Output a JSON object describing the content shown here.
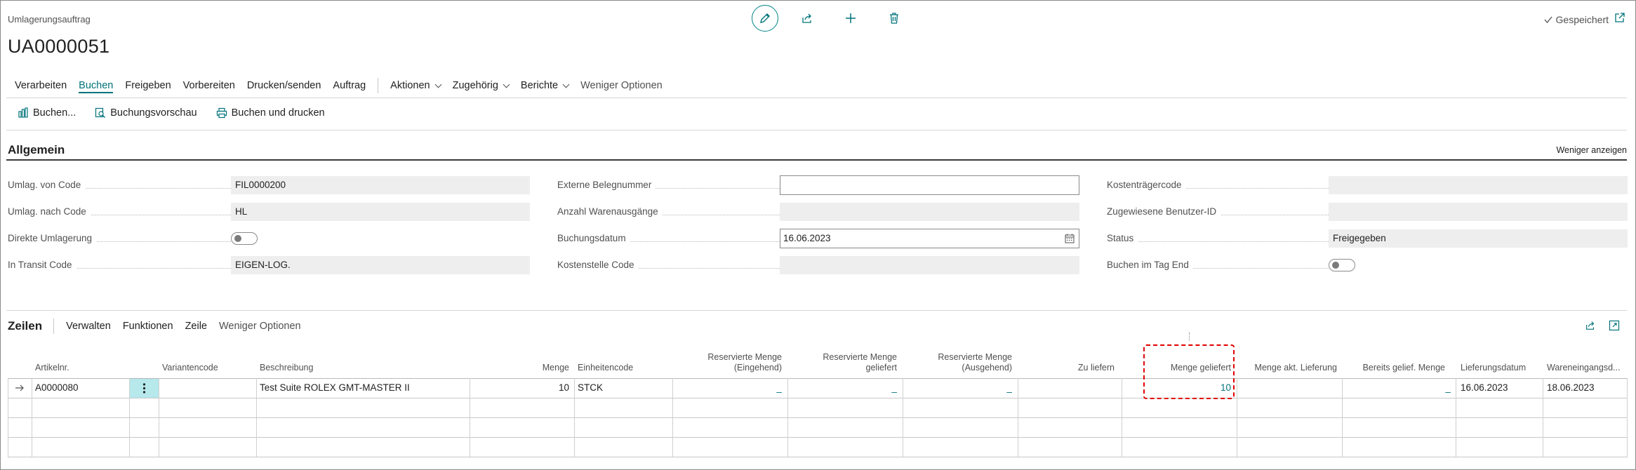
{
  "header": {
    "caption": "Umlagerungsauftrag",
    "title": "UA0000051",
    "saved_label": "Gespeichert"
  },
  "topbar_icons": [
    "pencil-edit-icon",
    "share-icon",
    "plus-icon",
    "trash-icon"
  ],
  "actions": {
    "items": [
      "Verarbeiten",
      "Buchen",
      "Freigeben",
      "Vorbereiten",
      "Drucken/senden",
      "Auftrag"
    ],
    "active": "Buchen",
    "dropdowns": [
      "Aktionen",
      "Zugehörig",
      "Berichte"
    ],
    "less_options": "Weniger Optionen"
  },
  "subactions": {
    "post": "Buchen...",
    "preview": "Buchungsvorschau",
    "post_print": "Buchen und drucken"
  },
  "general": {
    "title": "Allgemein",
    "show_less": "Weniger anzeigen",
    "col1": [
      {
        "label": "Umlag. von Code",
        "value": "FIL0000200"
      },
      {
        "label": "Umlag. nach Code",
        "value": "HL"
      },
      {
        "label": "Direkte Umlagerung",
        "toggle": false
      },
      {
        "label": "In Transit Code",
        "value": "EIGEN-LOG."
      }
    ],
    "col2": [
      {
        "label": "Externe Belegnummer",
        "value": ""
      },
      {
        "label": "Anzahl Warenausgänge",
        "value": ""
      },
      {
        "label": "Buchungsdatum",
        "value": "16.06.2023"
      },
      {
        "label": "Kostenstelle Code",
        "value": ""
      }
    ],
    "col3": [
      {
        "label": "Kostenträgercode",
        "value": ""
      },
      {
        "label": "Zugewiesene Benutzer-ID",
        "value": ""
      },
      {
        "label": "Status",
        "value": "Freigegeben"
      },
      {
        "label": "Buchen im Tag End",
        "toggle": false
      }
    ]
  },
  "lines": {
    "title": "Zeilen",
    "actions": [
      "Verwalten",
      "Funktionen",
      "Zeile"
    ],
    "less_options": "Weniger Optionen",
    "columns": {
      "item_no": "Artikelnr.",
      "variant": "Variantencode",
      "description": "Beschreibung",
      "quantity": "Menge",
      "unit": "Einheitencode",
      "res_in_1": "Reservierte Menge",
      "res_in_2": "(Eingehend)",
      "res_shipped_1": "Reservierte Menge",
      "res_shipped_2": "geliefert",
      "res_out_1": "Reservierte Menge",
      "res_out_2": "(Ausgehend)",
      "to_ship": "Zu liefern",
      "qty_shipped": "Menge geliefert",
      "qty_current": "Menge akt. Lieferung",
      "already_shipped": "Bereits gelief. Menge",
      "ship_date": "Lieferungsdatum",
      "receipt_date": "Wareneingangsd..."
    },
    "rows": [
      {
        "item_no": "A0000080",
        "variant": "",
        "description": "Test Suite ROLEX GMT-MASTER II",
        "quantity": "10",
        "unit": "STCK",
        "res_in": "_",
        "res_shipped": "_",
        "res_out": "_",
        "to_ship": "",
        "qty_shipped": "10",
        "qty_current": "",
        "already_shipped": "_",
        "ship_date": "16.06.2023",
        "receipt_date": "18.06.2023"
      }
    ]
  }
}
